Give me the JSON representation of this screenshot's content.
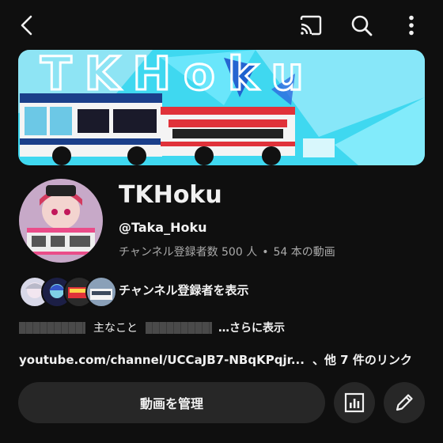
{
  "header": {
    "back_icon": "back-arrow-icon",
    "cast_icon": "cast-icon",
    "search_icon": "search-icon",
    "more_icon": "more-vertical-icon"
  },
  "banner": {
    "text": "TKHoku"
  },
  "channel": {
    "name": "TKHoku",
    "handle": "@Taka_Hoku",
    "subscribers": "チャンネル登録者数 500 人",
    "separator": "•",
    "videos": "54 本の動画"
  },
  "subscribers_link": {
    "label": "チャンネル登録者を表示"
  },
  "description": {
    "text": "主なこと",
    "more": "…さらに表示"
  },
  "links": {
    "url": "youtube.com/channel/UCCaJB7-NBqKPqjr...",
    "extra": "、他 7 件のリンク"
  },
  "actions": {
    "manage_label": "動画を管理",
    "analytics_icon": "analytics-icon",
    "edit_icon": "edit-pencil-icon"
  },
  "colors": {
    "background": "#0f0f0f",
    "button_bg": "#272727",
    "secondary_text": "#aaaaaa",
    "banner_cyan": "#3fd8f0"
  }
}
